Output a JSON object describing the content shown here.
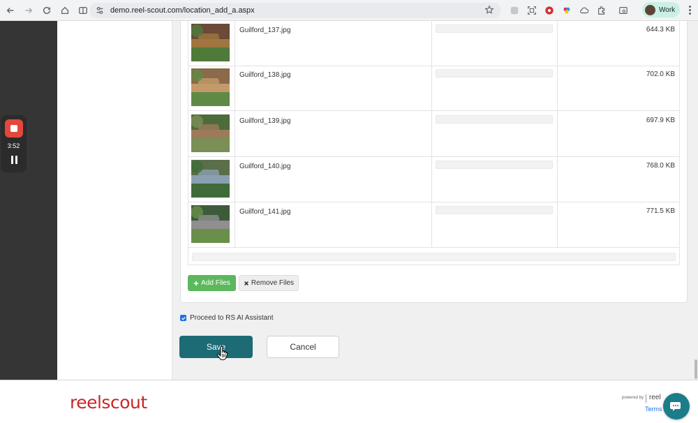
{
  "browser": {
    "url": "demo.reel-scout.com/location_add_a.aspx",
    "profile_label": "Work"
  },
  "recorder": {
    "time": "3:52"
  },
  "files": [
    {
      "name": "Guilford_137.jpg",
      "size": "644.3 KB",
      "progress": 0
    },
    {
      "name": "Guilford_138.jpg",
      "size": "702.0 KB",
      "progress": 0
    },
    {
      "name": "Guilford_139.jpg",
      "size": "697.9 KB",
      "progress": 0
    },
    {
      "name": "Guilford_140.jpg",
      "size": "768.0 KB",
      "progress": 0
    },
    {
      "name": "Guilford_141.jpg",
      "size": "771.5 KB",
      "progress": 0
    }
  ],
  "upload_actions": {
    "add_label": "Add Files",
    "remove_label": "Remove Files"
  },
  "proceed": {
    "label": "Proceed to RS AI Assistant",
    "checked": true
  },
  "form_actions": {
    "save_label": "Save",
    "cancel_label": "Cancel"
  },
  "footer": {
    "logo_text": "reelscout",
    "powered_by": "powered by",
    "powered_logo": "reel",
    "terms": "Terms &"
  },
  "colors": {
    "primary": "#1c6b75",
    "success": "#5cb85c",
    "brand_red": "#c62828"
  }
}
